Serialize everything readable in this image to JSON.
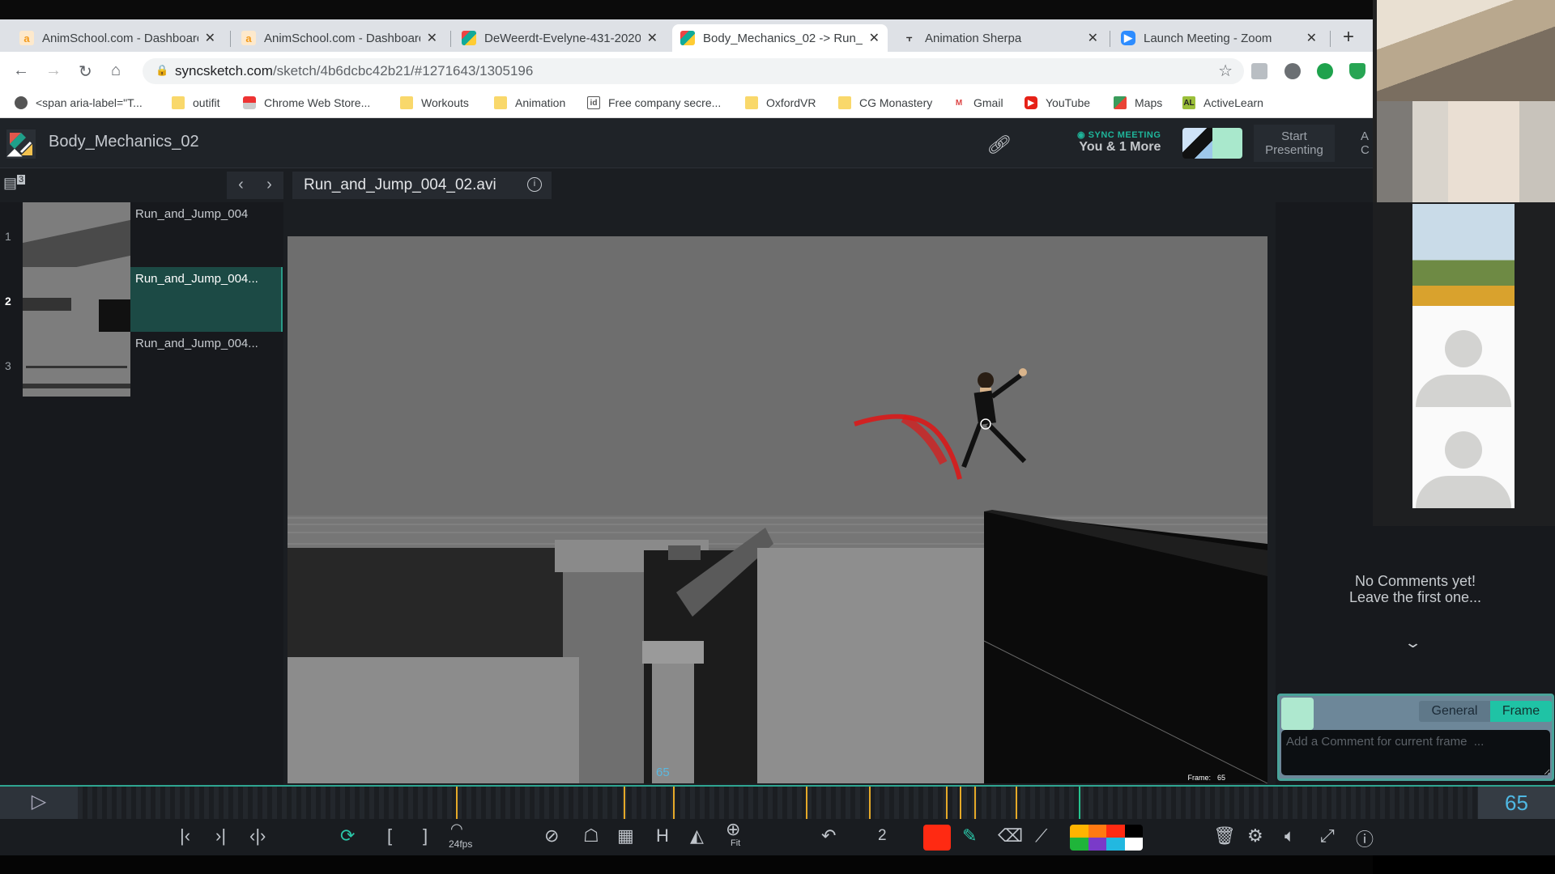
{
  "browser": {
    "tabs": [
      {
        "title": "AnimSchool.com - Dashboard",
        "favicon": "animschool-icon",
        "active": false
      },
      {
        "title": "AnimSchool.com - Dashboard",
        "favicon": "animschool-icon",
        "active": false
      },
      {
        "title": "DeWeerdt-Evelyne-431-2020",
        "favicon": "syncsketch-icon",
        "active": false
      },
      {
        "title": "Body_Mechanics_02 -> Run_",
        "favicon": "syncsketch-icon",
        "active": true
      },
      {
        "title": "Animation Sherpa",
        "favicon": "sherpa-icon",
        "active": false
      },
      {
        "title": "Launch Meeting - Zoom",
        "favicon": "zoom-icon",
        "active": false
      }
    ],
    "close_glyph": "✕",
    "new_tab_glyph": "+",
    "url_host": "syncsketch.com",
    "url_path": "/sketch/4b6dcbc42b21/#1271643/1305196",
    "bookmarks": [
      {
        "label": "<span aria-label=\"T...",
        "icon": "globe-icon"
      },
      {
        "label": "outifit",
        "icon": "folder-icon"
      },
      {
        "label": "Chrome Web Store...",
        "icon": "chrome-webstore-icon"
      },
      {
        "label": "Workouts",
        "icon": "folder-icon"
      },
      {
        "label": "Animation",
        "icon": "folder-icon"
      },
      {
        "label": "Free company secre...",
        "icon": "id-icon"
      },
      {
        "label": "OxfordVR",
        "icon": "folder-icon"
      },
      {
        "label": "CG Monastery",
        "icon": "folder-icon"
      },
      {
        "label": "Gmail",
        "icon": "gmail-icon"
      },
      {
        "label": "YouTube",
        "icon": "youtube-icon"
      },
      {
        "label": "Maps",
        "icon": "maps-icon"
      },
      {
        "label": "ActiveLearn",
        "icon": "activelearn-icon"
      }
    ]
  },
  "app": {
    "project_title": "Body_Mechanics_02",
    "sync_label": "SYNC MEETING",
    "sync_participants": "You & 1 More",
    "start_presenting": "Start Presenting",
    "more_button_partial": "A C",
    "list_count": "3",
    "current_file": "Run_and_Jump_004_02.avi",
    "prev_glyph": "‹",
    "next_glyph": "›",
    "info_glyph": "i",
    "review_items": [
      {
        "index": "1",
        "name": "Run_and_Jump_004",
        "selected": false
      },
      {
        "index": "2",
        "name": "Run_and_Jump_004...",
        "selected": true
      },
      {
        "index": "3",
        "name": "Run_and_Jump_004...",
        "selected": false
      }
    ],
    "viewer": {
      "frame_overlay": "65",
      "hud_frame_label": "Frame:",
      "hud_frame_value": "65"
    },
    "comments": {
      "empty_line1": "No Comments yet!",
      "empty_line2": "Leave the first one...",
      "tab_general": "General",
      "tab_frame": "Frame",
      "active_tab": "Frame",
      "input_placeholder": "Add a Comment for current frame  ..."
    },
    "timeline": {
      "current_frame": "65",
      "total_frames_est": 200,
      "marker_frames_est": [
        54,
        78,
        85,
        104,
        113,
        124,
        126,
        128,
        134
      ],
      "playhead_frame_est": 143
    },
    "toolbar": {
      "fps": "24fps",
      "fit_label": "Fit",
      "brush_size": "2",
      "brush_color": "#ff2a12",
      "palette": [
        "#ffb400",
        "#ff7a12",
        "#ff2a12",
        "#000000",
        "#1fb53a",
        "#7a3ac9",
        "#22b8e0",
        "#ffffff"
      ]
    }
  },
  "zoom_gallery": {
    "participants": [
      "camera-feed-1",
      "camera-feed-2",
      "profile-photo",
      "avatar-placeholder",
      "avatar-placeholder"
    ]
  }
}
